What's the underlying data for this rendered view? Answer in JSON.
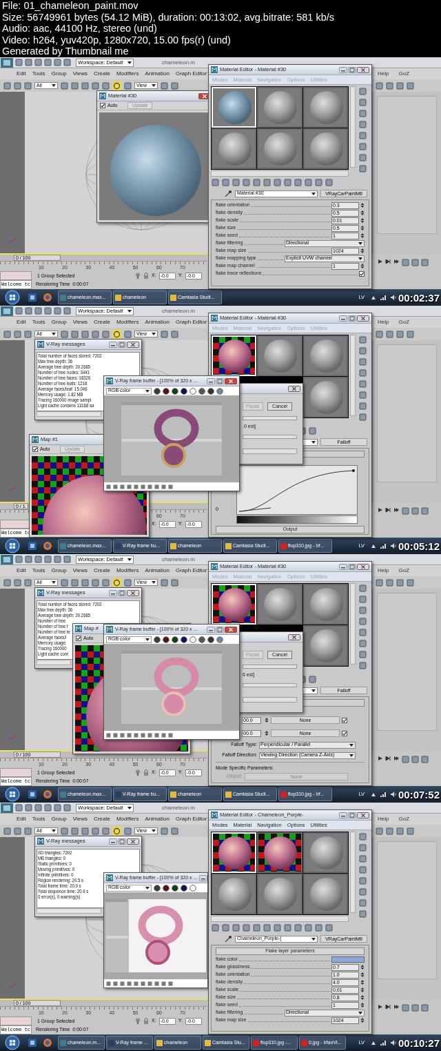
{
  "info": {
    "lines": [
      "File: 01_chameleon_paint.mov",
      "Size: 56749961 bytes (54.12 MiB), duration: 00:13:02, avg.bitrate: 581 kb/s",
      "Audio: aac, 44100 Hz, stereo (und)",
      "Video: h264, yuv420p, 1280x720, 15.00 fps(r) (und)",
      "Generated by Thumbnail me"
    ]
  },
  "frames": [
    {
      "timestamp": "00:02:37",
      "max": {
        "workspace": "Workspace: Default",
        "title": "chameleon.m",
        "menus": [
          "Edit",
          "Tools",
          "Group",
          "Views",
          "Create",
          "Modifiers",
          "Animation",
          "Graph Editor"
        ],
        "right_menus": [
          "Help",
          "GoZ"
        ],
        "selection_filter": "All",
        "view": "View",
        "time_slider": {
          "label": "0 / 100"
        },
        "ruler": [
          "10",
          "20",
          "30",
          "40",
          "50",
          "60",
          "70"
        ],
        "status": "1 Group Selected",
        "prompt": "Rendering Time  0:00:07",
        "listener": "Welcome tc",
        "x_label": "X:",
        "x_value": "-0.0",
        "y_label": "Y:",
        "y_value": "-0.0"
      },
      "windows": [
        {
          "kind": "preview",
          "title": "Material #30",
          "auto_label": "Auto",
          "auto_checked": true,
          "update_label": "Update"
        },
        {
          "kind": "material_editor",
          "title": "Material Editor - Material #30",
          "menus": [
            "Modes",
            "Material",
            "Navigation",
            "Options",
            "Utilities"
          ],
          "menus_enabled": false,
          "slots": [
            {
              "kind": "material",
              "selected": true
            },
            {
              "kind": "plain",
              "selected": false
            },
            {
              "kind": "plain",
              "selected": false
            },
            {
              "kind": "plain",
              "selected": false
            },
            {
              "kind": "plain",
              "selected": false
            },
            {
              "kind": "plain",
              "selected": false
            }
          ],
          "material_name": "Material #30",
          "type_button": "VRayCarPaintMtl",
          "panel": [
            {
              "kind": "spinner",
              "label": "flake orientation",
              "value": "0.3"
            },
            {
              "kind": "spinner",
              "label": "flake density",
              "value": "0.5"
            },
            {
              "kind": "spinner",
              "label": "flake scale",
              "value": "0.01"
            },
            {
              "kind": "spinner",
              "label": "flake size",
              "value": "0.5"
            },
            {
              "kind": "spinner",
              "label": "flake seed",
              "value": "1"
            },
            {
              "kind": "dropdown",
              "label": "flake filtering",
              "value": "Directional"
            },
            {
              "kind": "spinner",
              "label": "flake map size",
              "value": "1024"
            },
            {
              "kind": "dropdown",
              "label": "flake mapping type",
              "value": "Explicit UVW channel"
            },
            {
              "kind": "spinner",
              "label": "flake map channel",
              "value": "1"
            },
            {
              "kind": "checkbox",
              "label": "flake trace reflections",
              "checked": true
            }
          ]
        }
      ],
      "taskbar": {
        "items": [
          "chameleon.max...",
          "chameleon",
          "Camtasia Studi..."
        ],
        "language": "LV"
      }
    },
    {
      "timestamp": "00:05:12",
      "max": {
        "workspace": "Workspace: Default",
        "title": "chameleon.m",
        "menus": [
          "Edit",
          "Tools",
          "Group",
          "Views",
          "Create",
          "Modifiers",
          "Animation",
          "Graph Editor"
        ],
        "right_menus": [
          "Help",
          "GoZ"
        ],
        "selection_filter": "All",
        "view": "View",
        "time_slider": {
          "label": "0 / 1"
        },
        "ruler": [
          "60",
          "70"
        ],
        "listener": "Welcome tc",
        "x_label": "X:",
        "x_value": "-0.0",
        "y_label": "Y:",
        "y_value": "-0.0"
      },
      "windows": [
        {
          "kind": "messages",
          "title": "V-Ray messages",
          "lines": [
            "Total number of faces stored: 7202",
            "Max tree depth: 36",
            "Average tree depth: 20.2685",
            "Number of tree nodes: 3441",
            "Number of tree faces: 18326",
            "Number of tree leafs: 1218",
            "Average faces/leaf: 15.046",
            "Memory usage: 1.82 MB",
            "Tracing 160000 image sampl",
            "Light cache contains 13168 sa"
          ]
        },
        {
          "kind": "preview",
          "title": "Map #1",
          "auto_label": "Auto",
          "auto_checked": true,
          "update_label": "Update"
        },
        {
          "kind": "material_editor",
          "title": "Material Editor - Material #30",
          "menus": [
            "Modes",
            "Material",
            "Navigation",
            "Options",
            "Utilities"
          ],
          "menus_enabled": false,
          "slots": [
            {
              "kind": "checker",
              "selected": true
            },
            {
              "kind": "plain",
              "selected": false
            },
            {
              "kind": "plain",
              "selected": false
            },
            {
              "kind": "plain",
              "selected": false
            }
          ],
          "type_button": "Falloff",
          "panel": [
            {
              "kind": "rollout"
            },
            {
              "kind": "curve",
              "axis_label": "0"
            },
            {
              "kind": "gradient"
            },
            {
              "kind": "rollout",
              "title": "Output"
            }
          ]
        },
        {
          "kind": "progress",
          "pause_label": "Pause",
          "cancel_label": "Cancel",
          "estimate": ".0 est]",
          "bars": [
            {
              "level": 0
            },
            {
              "level": 0
            },
            {
              "level": 0
            }
          ]
        },
        {
          "kind": "frame_buffer",
          "title": "V-Ray frame buffer - [100% of 320 x ...",
          "channel": "RGB color"
        }
      ],
      "taskbar": {
        "items": [
          "chameleon.max...",
          "V-Ray frame bu...",
          "chameleon",
          "Camtasia Studi...",
          "flop310.jpg - Irf..."
        ],
        "language": "LV"
      }
    },
    {
      "timestamp": "00:07:52",
      "max": {
        "workspace": "Workspace: Default",
        "title": "chameleon.m",
        "menus": [
          "Edit",
          "Tools",
          "Group",
          "Views",
          "Create",
          "Modifiers",
          "Animation",
          "Graph Editor"
        ],
        "right_menus": [
          "Help",
          "GoZ"
        ],
        "selection_filter": "All",
        "view": "View",
        "time_slider": {
          "label": "0 / 100"
        },
        "ruler": [
          "10",
          "20",
          "30",
          "40",
          "50",
          "60",
          "70"
        ],
        "status": "1 Group Selected",
        "prompt": "Rendering Time  0:00:07",
        "listener": "Welcome tc",
        "x_label": "X:",
        "x_value": "-0.0",
        "y_label": "Y:",
        "y_value": "-0.0"
      },
      "windows": [
        {
          "kind": "messages",
          "title": "V-Ray messages",
          "lines": [
            "Total number of faces stored: 7202",
            "Max tree depth: 36",
            "Average tree depth: 20.2685",
            "Number of tree",
            "Number of tree f",
            "Number of tree le",
            "Average faces/l",
            "Memory usage:",
            "Tracing 160000",
            "Light cache cont"
          ]
        },
        {
          "kind": "preview",
          "title": "Map #",
          "auto_label": "Auto",
          "auto_checked": true
        },
        {
          "kind": "material_editor",
          "title": "Material Editor - Material #30",
          "menus": [
            "Modes",
            "Material",
            "Navigation",
            "Options",
            "Utilities"
          ],
          "menus_enabled": false,
          "slots": [
            {
              "kind": "checker",
              "selected": true
            },
            {
              "kind": "plain",
              "selected": false
            },
            {
              "kind": "plain",
              "selected": false
            },
            {
              "kind": "plain",
              "selected": false
            }
          ],
          "type_button": "Falloff",
          "panel": [
            {
              "kind": "rollout"
            },
            {
              "kind": "map_slot",
              "value": "00.0",
              "button": "None",
              "checked": true
            },
            {
              "kind": "map_slot",
              "value": "00.0",
              "button": "None",
              "checked": true
            },
            {
              "kind": "labeled_dropdown",
              "label": "Falloff Type:",
              "value": "Perpendicular / Parallel"
            },
            {
              "kind": "labeled_dropdown",
              "label": "Falloff Direction:",
              "value": "Viewing Direction (Camera Z-Axis)"
            },
            {
              "kind": "group_label",
              "label": "Mode Specific Parameters:"
            },
            {
              "kind": "object_button",
              "label": "Object:",
              "button": "None"
            }
          ]
        },
        {
          "kind": "progress",
          "pause_label": "Pause",
          "cancel_label": "Cancel",
          "estimate": "6 est]",
          "bars": [
            {
              "level": 0
            },
            {
              "level": 0
            },
            {
              "level": 0
            }
          ]
        },
        {
          "kind": "frame_buffer",
          "title": "V-Ray frame buffer - [100% of 320 x ...",
          "channel": "RGB color"
        }
      ],
      "taskbar": {
        "items": [
          "chameleon.max...",
          "V-Ray frame bu...",
          "chameleon",
          "Camtasia Studi...",
          "flop310.jpg - Irf..."
        ],
        "language": "LV"
      }
    },
    {
      "timestamp": "00:10:27",
      "max": {
        "workspace": "Workspace: Default",
        "title": "chameleon.m",
        "menus": [
          "Edit",
          "Tools",
          "Group",
          "Views",
          "Create",
          "Modifiers",
          "Animation",
          "Graph Editor"
        ],
        "right_menus": [
          "Help",
          "GoZ"
        ],
        "selection_filter": "All",
        "view": "View",
        "time_slider": {
          "label": "0 / 100"
        },
        "ruler": [
          "10",
          "20",
          "30",
          "40",
          "50",
          "60",
          "70"
        ],
        "status": "1 Group Selected",
        "prompt": "Rendering Time  0:00:07",
        "listener": "Welcome tc",
        "x_label": "X:",
        "x_value": "-0.0",
        "y_label": "Y:",
        "y_value": "-0.0"
      },
      "windows": [
        {
          "kind": "messages",
          "title": "V-Ray messages",
          "lines": [
            "SD triangles: 7202",
            "MB triangles: 0",
            "Static primitives: 0",
            "Moving primitives: 0",
            "Infinite primitives: 0",
            "Region rendering: 20.5 s",
            "Total frame time: 20.9 s",
            "Total sequence time: 20.9 s",
            "0 error(s), 0 warning(s)"
          ]
        },
        {
          "kind": "frame_buffer",
          "title": "V-Ray frame buffer - [100% of 320 x ...",
          "channel": "RGB color"
        },
        {
          "kind": "material_editor",
          "title": "Material Editor - Chameleon_Purple-",
          "menus": [
            "Modes",
            "Material",
            "Navigation",
            "Options",
            "Utilities"
          ],
          "menus_enabled": true,
          "slots": [
            {
              "kind": "checker",
              "selected": true
            },
            {
              "kind": "checker",
              "selected": false
            },
            {
              "kind": "plain",
              "selected": false
            },
            {
              "kind": "plain",
              "selected": false
            },
            {
              "kind": "plain",
              "selected": false
            },
            {
              "kind": "plain",
              "selected": false
            }
          ],
          "material_name": "Chameleon_Purple-(",
          "type_button": "VRayCarPaintMtl",
          "panel": [
            {
              "kind": "rollout",
              "title": "Flake layer parameters"
            },
            {
              "kind": "color",
              "label": "flake color",
              "color": "#8ea6dc"
            },
            {
              "kind": "spinner",
              "label": "flake glossiness",
              "value": "0.7"
            },
            {
              "kind": "spinner",
              "label": "flake orientation",
              "value": "1.0"
            },
            {
              "kind": "spinner",
              "label": "flake density",
              "value": "4.0"
            },
            {
              "kind": "spinner",
              "label": "flake scale",
              "value": "0.01"
            },
            {
              "kind": "spinner",
              "label": "flake size",
              "value": "0.8"
            },
            {
              "kind": "spinner",
              "label": "flake seed",
              "value": "1"
            },
            {
              "kind": "dropdown",
              "label": "flake filtering",
              "value": "Directional"
            },
            {
              "kind": "spinner",
              "label": "flake map size",
              "value": "1024"
            }
          ]
        }
      ],
      "taskbar": {
        "items": [
          "chameleon.m...",
          "V-Ray frame ...",
          "chameleon",
          "Camtasia Stu...",
          "flop310.jpg -...",
          "0.jpg - IrfanVi..."
        ],
        "language": "LV"
      }
    }
  ]
}
